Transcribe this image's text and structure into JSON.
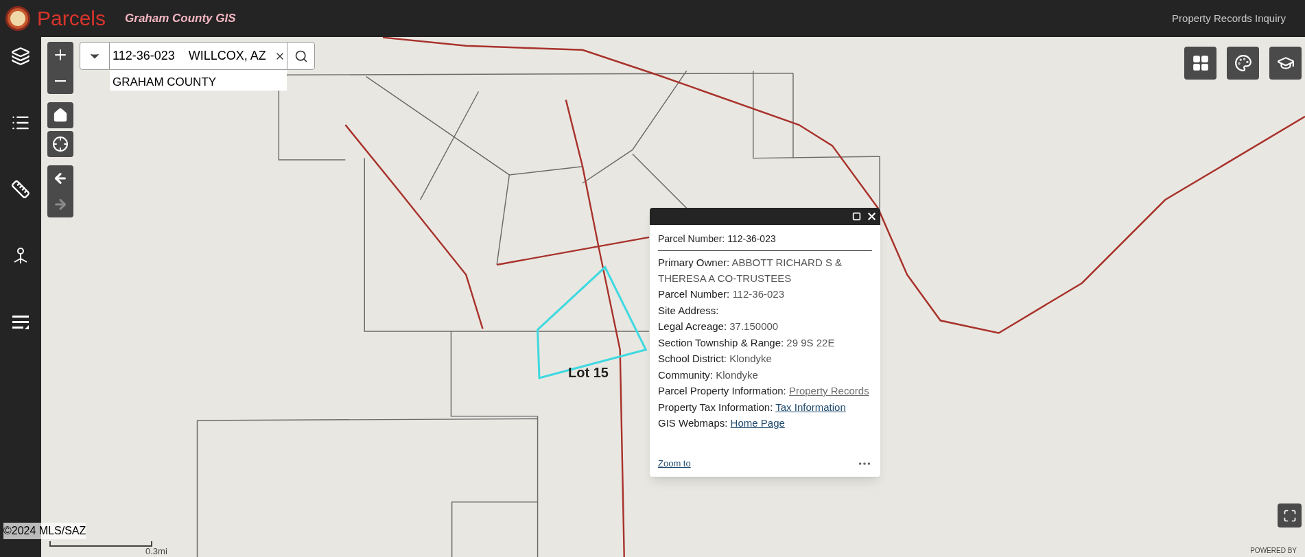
{
  "header": {
    "app_title": "Parcels",
    "subtitle": "Graham County GIS",
    "right_link": "Property Records Inquiry"
  },
  "search": {
    "value": "112-36-023    WILLCOX, AZ",
    "suggestions": [
      "GRAHAM COUNTY"
    ]
  },
  "navigation": {
    "back_disabled": false,
    "forward_disabled": true
  },
  "map": {
    "feature_label": "Lot 15",
    "scale_label": "0.3mi",
    "attribution": "©2024 MLS/SAZ",
    "powered_by": "POWERED BY"
  },
  "popup": {
    "title_label": "Parcel Number:",
    "title_value": "112-36-023",
    "fields": [
      {
        "kind": "value",
        "label": "Primary Owner:",
        "value": "ABBOTT RICHARD S & THERESA A CO-TRUSTEES"
      },
      {
        "kind": "value",
        "label": "Parcel Number:",
        "value": "112-36-023"
      },
      {
        "kind": "value",
        "label": "Site Address:"
      },
      {
        "kind": "value",
        "label": "Legal Acreage:",
        "value": "37.150000"
      },
      {
        "kind": "value",
        "label": "Section Township & Range:",
        "value": "29 9S 22E"
      },
      {
        "kind": "value",
        "label": "School District:",
        "value": "Klondyke"
      },
      {
        "kind": "value",
        "label": "Community:",
        "value": "Klondyke"
      },
      {
        "kind": "link",
        "label": "Parcel Property Information:",
        "value": "Property Records",
        "visited": true
      },
      {
        "kind": "link",
        "label": "Property Tax Information:",
        "value": "Tax Information",
        "visited": false
      },
      {
        "kind": "link",
        "label": "GIS Webmaps:",
        "value": "Home Page",
        "visited": false
      }
    ],
    "footer_link": "Zoom to"
  }
}
